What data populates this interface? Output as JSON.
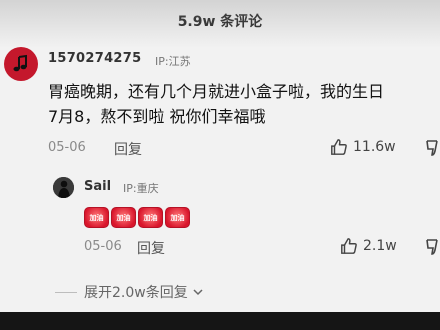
{
  "header": {
    "title": "5.9w 条评论"
  },
  "comment": {
    "username": "1570274275",
    "ip": "IP:江苏",
    "text_line1": "胃癌晚期，还有几个月就进小盒子啦，我的生日",
    "text_line2": "7月8，熬不到啦 祝你们幸福哦",
    "date": "05-06",
    "reply_label": "回复",
    "likes": "11.6w"
  },
  "reply": {
    "username": "Sail",
    "ip": "IP:重庆",
    "stickers": [
      "加油",
      "加油",
      "加油",
      "加油"
    ],
    "date": "05-06",
    "reply_label": "回复",
    "likes": "2.1w"
  },
  "expand_label": "展开2.0w条回复",
  "icons": {
    "avatar": "music-note-icon",
    "like": "thumb-up-icon",
    "dislike": "thumb-down-icon",
    "expand": "chevron-down-icon"
  },
  "colors": {
    "accent_red": "#c4182c",
    "background": "#f2f2f2"
  }
}
